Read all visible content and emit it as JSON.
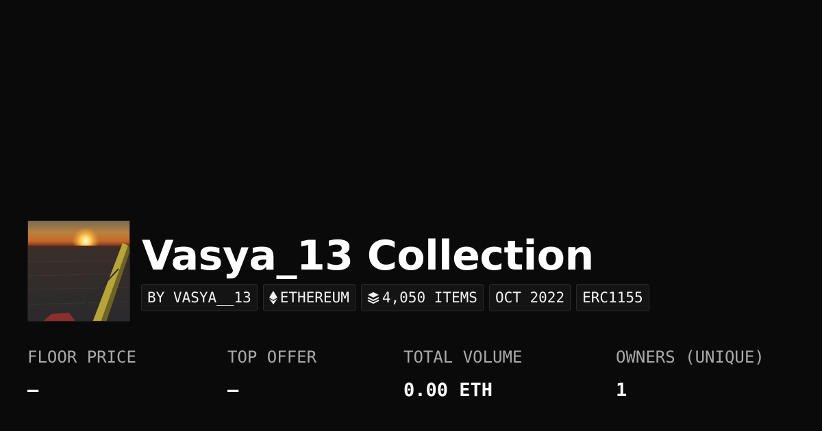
{
  "collection": {
    "title": "Vasya_13 Collection",
    "avatar_icon": "sunset-photo"
  },
  "badges": [
    {
      "label": "BY VASYA__13",
      "icon": ""
    },
    {
      "label": "ETHEREUM",
      "icon": "ethereum-diamond-icon"
    },
    {
      "label": "4,050 ITEMS",
      "icon": "stacked-layers-icon"
    },
    {
      "label": "OCT 2022",
      "icon": ""
    },
    {
      "label": "ERC1155",
      "icon": ""
    }
  ],
  "stats": [
    {
      "label": "FLOOR PRICE",
      "value": "–"
    },
    {
      "label": "TOP OFFER",
      "value": "–"
    },
    {
      "label": "TOTAL VOLUME",
      "value": "0.00 ETH"
    },
    {
      "label": "OWNERS (UNIQUE)",
      "value": "1"
    }
  ],
  "colors": {
    "background": "#0a0a0a",
    "badge_background": "#141414",
    "label_gray": "#a9a9a9",
    "text_white": "#ffffff"
  }
}
